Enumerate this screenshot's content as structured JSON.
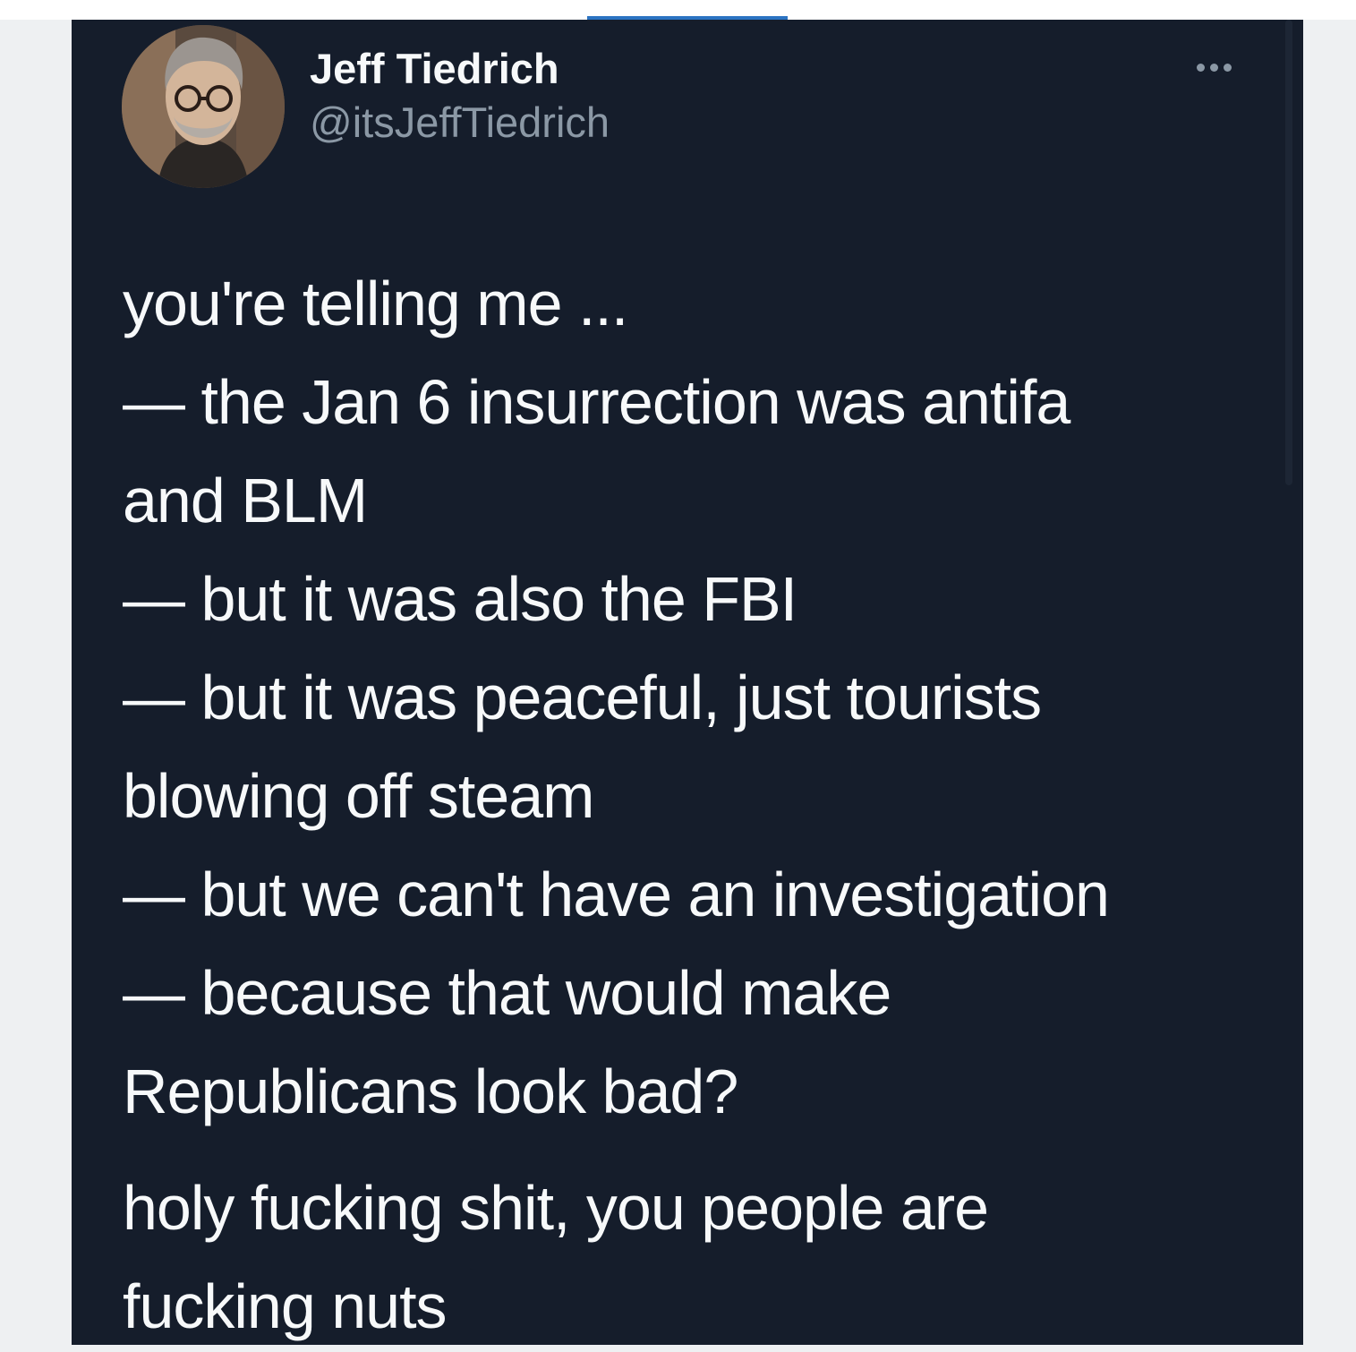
{
  "tweet": {
    "author": {
      "display_name": "Jeff Tiedrich",
      "handle": "@itsJeffTiedrich",
      "avatar_icon": "profile-photo"
    },
    "more_icon": "more-horizontal-icon",
    "lines": [
      "you're telling me ...",
      "— the Jan 6 insurrection was antifa",
      "and BLM",
      "— but it was also the FBI",
      "— but it was peaceful, just tourists",
      "blowing off steam",
      "— but we can't have an investigation",
      "— because that would make",
      "Republicans look bad?"
    ],
    "closing_lines": [
      "holy fucking shit, you people are",
      "fucking nuts"
    ]
  },
  "colors": {
    "card_background": "#151d2b",
    "primary_text": "#f7f9fa",
    "secondary_text": "#8b98a5",
    "accent": "#2b73c2",
    "page_background": "#eef0f2"
  }
}
